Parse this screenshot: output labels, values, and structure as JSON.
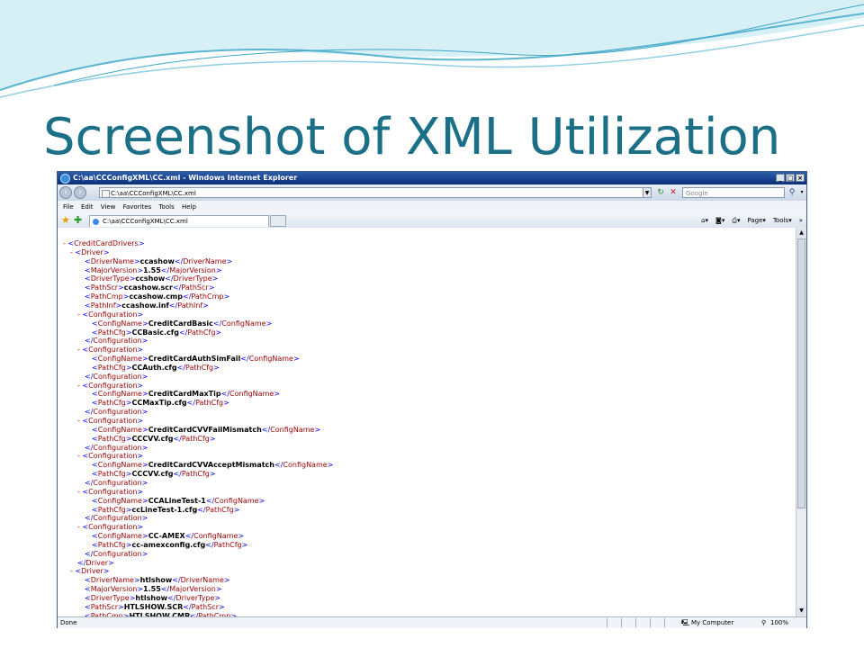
{
  "slide": {
    "title": "Screenshot of XML Utilization"
  },
  "browser": {
    "window_title": "C:\\aa\\CCConfigXML\\CC.xml - Windows Internet Explorer",
    "address": "C:\\aa\\CCConfigXML\\CC.xml",
    "search_placeholder": "Google",
    "menu": [
      "File",
      "Edit",
      "View",
      "Favorites",
      "Tools",
      "Help"
    ],
    "tab_label": "C:\\aa\\CCConfigXML\\CC.xml",
    "toolbar": {
      "page": "Page",
      "tools": "Tools"
    },
    "status": {
      "left": "Done",
      "zone": "My Computer",
      "zoom": "100%"
    }
  },
  "xml_lines": [
    {
      "indent": 0,
      "toggle": "-",
      "parts": [
        [
          "b",
          "<"
        ],
        [
          "t",
          "CreditCardDrivers"
        ],
        [
          "b",
          ">"
        ]
      ]
    },
    {
      "indent": 1,
      "toggle": "-",
      "parts": [
        [
          "b",
          "<"
        ],
        [
          "t",
          "Driver"
        ],
        [
          "b",
          ">"
        ]
      ]
    },
    {
      "indent": 2,
      "toggle": "",
      "parts": [
        [
          "b",
          "<"
        ],
        [
          "t",
          "DriverName"
        ],
        [
          "b",
          ">"
        ],
        [
          "v",
          "ccashow"
        ],
        [
          "b",
          "</"
        ],
        [
          "t",
          "DriverName"
        ],
        [
          "b",
          ">"
        ]
      ]
    },
    {
      "indent": 2,
      "toggle": "",
      "parts": [
        [
          "b",
          "<"
        ],
        [
          "t",
          "MajorVersion"
        ],
        [
          "b",
          ">"
        ],
        [
          "v",
          "1.55"
        ],
        [
          "b",
          "</"
        ],
        [
          "t",
          "MajorVersion"
        ],
        [
          "b",
          ">"
        ]
      ]
    },
    {
      "indent": 2,
      "toggle": "",
      "parts": [
        [
          "b",
          "<"
        ],
        [
          "t",
          "DriverType"
        ],
        [
          "b",
          ">"
        ],
        [
          "v",
          "ccshow"
        ],
        [
          "b",
          "</"
        ],
        [
          "t",
          "DriverType"
        ],
        [
          "b",
          ">"
        ]
      ]
    },
    {
      "indent": 2,
      "toggle": "",
      "parts": [
        [
          "b",
          "<"
        ],
        [
          "t",
          "PathScr"
        ],
        [
          "b",
          ">"
        ],
        [
          "v",
          "ccashow.scr"
        ],
        [
          "b",
          "</"
        ],
        [
          "t",
          "PathScr"
        ],
        [
          "b",
          ">"
        ]
      ]
    },
    {
      "indent": 2,
      "toggle": "",
      "parts": [
        [
          "b",
          "<"
        ],
        [
          "t",
          "PathCmp"
        ],
        [
          "b",
          ">"
        ],
        [
          "v",
          "ccashow.cmp"
        ],
        [
          "b",
          "</"
        ],
        [
          "t",
          "PathCmp"
        ],
        [
          "b",
          ">"
        ]
      ]
    },
    {
      "indent": 2,
      "toggle": "",
      "parts": [
        [
          "b",
          "<"
        ],
        [
          "t",
          "PathInf"
        ],
        [
          "b",
          ">"
        ],
        [
          "v",
          "ccashow.inf"
        ],
        [
          "b",
          "</"
        ],
        [
          "t",
          "PathInf"
        ],
        [
          "b",
          ">"
        ]
      ]
    },
    {
      "indent": 2,
      "toggle": "-",
      "parts": [
        [
          "b",
          "<"
        ],
        [
          "t",
          "Configuration"
        ],
        [
          "b",
          ">"
        ]
      ]
    },
    {
      "indent": 3,
      "toggle": "",
      "parts": [
        [
          "b",
          "<"
        ],
        [
          "t",
          "ConfigName"
        ],
        [
          "b",
          ">"
        ],
        [
          "v",
          "CreditCardBasic"
        ],
        [
          "b",
          "</"
        ],
        [
          "t",
          "ConfigName"
        ],
        [
          "b",
          ">"
        ]
      ]
    },
    {
      "indent": 3,
      "toggle": "",
      "parts": [
        [
          "b",
          "<"
        ],
        [
          "t",
          "PathCfg"
        ],
        [
          "b",
          ">"
        ],
        [
          "v",
          "CCBasic.cfg"
        ],
        [
          "b",
          "</"
        ],
        [
          "t",
          "PathCfg"
        ],
        [
          "b",
          ">"
        ]
      ]
    },
    {
      "indent": 2,
      "toggle": "",
      "parts": [
        [
          "b",
          "</"
        ],
        [
          "t",
          "Configuration"
        ],
        [
          "b",
          ">"
        ]
      ]
    },
    {
      "indent": 2,
      "toggle": "-",
      "parts": [
        [
          "b",
          "<"
        ],
        [
          "t",
          "Configuration"
        ],
        [
          "b",
          ">"
        ]
      ]
    },
    {
      "indent": 3,
      "toggle": "",
      "parts": [
        [
          "b",
          "<"
        ],
        [
          "t",
          "ConfigName"
        ],
        [
          "b",
          ">"
        ],
        [
          "v",
          "CreditCardAuthSimFail"
        ],
        [
          "b",
          "</"
        ],
        [
          "t",
          "ConfigName"
        ],
        [
          "b",
          ">"
        ]
      ]
    },
    {
      "indent": 3,
      "toggle": "",
      "parts": [
        [
          "b",
          "<"
        ],
        [
          "t",
          "PathCfg"
        ],
        [
          "b",
          ">"
        ],
        [
          "v",
          "CCAuth.cfg"
        ],
        [
          "b",
          "</"
        ],
        [
          "t",
          "PathCfg"
        ],
        [
          "b",
          ">"
        ]
      ]
    },
    {
      "indent": 2,
      "toggle": "",
      "parts": [
        [
          "b",
          "</"
        ],
        [
          "t",
          "Configuration"
        ],
        [
          "b",
          ">"
        ]
      ]
    },
    {
      "indent": 2,
      "toggle": "-",
      "parts": [
        [
          "b",
          "<"
        ],
        [
          "t",
          "Configuration"
        ],
        [
          "b",
          ">"
        ]
      ]
    },
    {
      "indent": 3,
      "toggle": "",
      "parts": [
        [
          "b",
          "<"
        ],
        [
          "t",
          "ConfigName"
        ],
        [
          "b",
          ">"
        ],
        [
          "v",
          "CreditCardMaxTip"
        ],
        [
          "b",
          "</"
        ],
        [
          "t",
          "ConfigName"
        ],
        [
          "b",
          ">"
        ]
      ]
    },
    {
      "indent": 3,
      "toggle": "",
      "parts": [
        [
          "b",
          "<"
        ],
        [
          "t",
          "PathCfg"
        ],
        [
          "b",
          ">"
        ],
        [
          "v",
          "CCMaxTip.cfg"
        ],
        [
          "b",
          "</"
        ],
        [
          "t",
          "PathCfg"
        ],
        [
          "b",
          ">"
        ]
      ]
    },
    {
      "indent": 2,
      "toggle": "",
      "parts": [
        [
          "b",
          "</"
        ],
        [
          "t",
          "Configuration"
        ],
        [
          "b",
          ">"
        ]
      ]
    },
    {
      "indent": 2,
      "toggle": "-",
      "parts": [
        [
          "b",
          "<"
        ],
        [
          "t",
          "Configuration"
        ],
        [
          "b",
          ">"
        ]
      ]
    },
    {
      "indent": 3,
      "toggle": "",
      "parts": [
        [
          "b",
          "<"
        ],
        [
          "t",
          "ConfigName"
        ],
        [
          "b",
          ">"
        ],
        [
          "v",
          "CreditCardCVVFailMismatch"
        ],
        [
          "b",
          "</"
        ],
        [
          "t",
          "ConfigName"
        ],
        [
          "b",
          ">"
        ]
      ]
    },
    {
      "indent": 3,
      "toggle": "",
      "parts": [
        [
          "b",
          "<"
        ],
        [
          "t",
          "PathCfg"
        ],
        [
          "b",
          ">"
        ],
        [
          "v",
          "CCCVV.cfg"
        ],
        [
          "b",
          "</"
        ],
        [
          "t",
          "PathCfg"
        ],
        [
          "b",
          ">"
        ]
      ]
    },
    {
      "indent": 2,
      "toggle": "",
      "parts": [
        [
          "b",
          "</"
        ],
        [
          "t",
          "Configuration"
        ],
        [
          "b",
          ">"
        ]
      ]
    },
    {
      "indent": 2,
      "toggle": "-",
      "parts": [
        [
          "b",
          "<"
        ],
        [
          "t",
          "Configuration"
        ],
        [
          "b",
          ">"
        ]
      ]
    },
    {
      "indent": 3,
      "toggle": "",
      "parts": [
        [
          "b",
          "<"
        ],
        [
          "t",
          "ConfigName"
        ],
        [
          "b",
          ">"
        ],
        [
          "v",
          "CreditCardCVVAcceptMismatch"
        ],
        [
          "b",
          "</"
        ],
        [
          "t",
          "ConfigName"
        ],
        [
          "b",
          ">"
        ]
      ]
    },
    {
      "indent": 3,
      "toggle": "",
      "parts": [
        [
          "b",
          "<"
        ],
        [
          "t",
          "PathCfg"
        ],
        [
          "b",
          ">"
        ],
        [
          "v",
          "CCCVV.cfg"
        ],
        [
          "b",
          "</"
        ],
        [
          "t",
          "PathCfg"
        ],
        [
          "b",
          ">"
        ]
      ]
    },
    {
      "indent": 2,
      "toggle": "",
      "parts": [
        [
          "b",
          "</"
        ],
        [
          "t",
          "Configuration"
        ],
        [
          "b",
          ">"
        ]
      ]
    },
    {
      "indent": 2,
      "toggle": "-",
      "parts": [
        [
          "b",
          "<"
        ],
        [
          "t",
          "Configuration"
        ],
        [
          "b",
          ">"
        ]
      ]
    },
    {
      "indent": 3,
      "toggle": "",
      "parts": [
        [
          "b",
          "<"
        ],
        [
          "t",
          "ConfigName"
        ],
        [
          "b",
          ">"
        ],
        [
          "v",
          "CCALineTest-1"
        ],
        [
          "b",
          "</"
        ],
        [
          "t",
          "ConfigName"
        ],
        [
          "b",
          ">"
        ]
      ]
    },
    {
      "indent": 3,
      "toggle": "",
      "parts": [
        [
          "b",
          "<"
        ],
        [
          "t",
          "PathCfg"
        ],
        [
          "b",
          ">"
        ],
        [
          "v",
          "ccLineTest-1.cfg"
        ],
        [
          "b",
          "</"
        ],
        [
          "t",
          "PathCfg"
        ],
        [
          "b",
          ">"
        ]
      ]
    },
    {
      "indent": 2,
      "toggle": "",
      "parts": [
        [
          "b",
          "</"
        ],
        [
          "t",
          "Configuration"
        ],
        [
          "b",
          ">"
        ]
      ]
    },
    {
      "indent": 2,
      "toggle": "-",
      "parts": [
        [
          "b",
          "<"
        ],
        [
          "t",
          "Configuration"
        ],
        [
          "b",
          ">"
        ]
      ]
    },
    {
      "indent": 3,
      "toggle": "",
      "parts": [
        [
          "b",
          "<"
        ],
        [
          "t",
          "ConfigName"
        ],
        [
          "b",
          ">"
        ],
        [
          "v",
          "CC-AMEX"
        ],
        [
          "b",
          "</"
        ],
        [
          "t",
          "ConfigName"
        ],
        [
          "b",
          ">"
        ]
      ]
    },
    {
      "indent": 3,
      "toggle": "",
      "parts": [
        [
          "b",
          "<"
        ],
        [
          "t",
          "PathCfg"
        ],
        [
          "b",
          ">"
        ],
        [
          "v",
          "cc-amexconfig.cfg"
        ],
        [
          "b",
          "</"
        ],
        [
          "t",
          "PathCfg"
        ],
        [
          "b",
          ">"
        ]
      ]
    },
    {
      "indent": 2,
      "toggle": "",
      "parts": [
        [
          "b",
          "</"
        ],
        [
          "t",
          "Configuration"
        ],
        [
          "b",
          ">"
        ]
      ]
    },
    {
      "indent": 1,
      "toggle": "",
      "parts": [
        [
          "b",
          "</"
        ],
        [
          "t",
          "Driver"
        ],
        [
          "b",
          ">"
        ]
      ]
    },
    {
      "indent": 1,
      "toggle": "-",
      "parts": [
        [
          "b",
          "<"
        ],
        [
          "t",
          "Driver"
        ],
        [
          "b",
          ">"
        ]
      ]
    },
    {
      "indent": 2,
      "toggle": "",
      "parts": [
        [
          "b",
          "<"
        ],
        [
          "t",
          "DriverName"
        ],
        [
          "b",
          ">"
        ],
        [
          "v",
          "htlshow"
        ],
        [
          "b",
          "</"
        ],
        [
          "t",
          "DriverName"
        ],
        [
          "b",
          ">"
        ]
      ]
    },
    {
      "indent": 2,
      "toggle": "",
      "parts": [
        [
          "b",
          "<"
        ],
        [
          "t",
          "MajorVersion"
        ],
        [
          "b",
          ">"
        ],
        [
          "v",
          "1.55"
        ],
        [
          "b",
          "</"
        ],
        [
          "t",
          "MajorVersion"
        ],
        [
          "b",
          ">"
        ]
      ]
    },
    {
      "indent": 2,
      "toggle": "",
      "parts": [
        [
          "b",
          "<"
        ],
        [
          "t",
          "DriverType"
        ],
        [
          "b",
          ">"
        ],
        [
          "v",
          "htlshow"
        ],
        [
          "b",
          "</"
        ],
        [
          "t",
          "DriverType"
        ],
        [
          "b",
          ">"
        ]
      ]
    },
    {
      "indent": 2,
      "toggle": "",
      "parts": [
        [
          "b",
          "<"
        ],
        [
          "t",
          "PathScr"
        ],
        [
          "b",
          ">"
        ],
        [
          "v",
          "HTLSHOW.SCR"
        ],
        [
          "b",
          "</"
        ],
        [
          "t",
          "PathScr"
        ],
        [
          "b",
          ">"
        ]
      ]
    },
    {
      "indent": 2,
      "toggle": "",
      "parts": [
        [
          "b",
          "<"
        ],
        [
          "t",
          "PathCmp"
        ],
        [
          "b",
          ">"
        ],
        [
          "v",
          "HTLSHOW.CMP"
        ],
        [
          "b",
          "</"
        ],
        [
          "t",
          "PathCmp"
        ],
        [
          "b",
          ">"
        ]
      ]
    }
  ]
}
